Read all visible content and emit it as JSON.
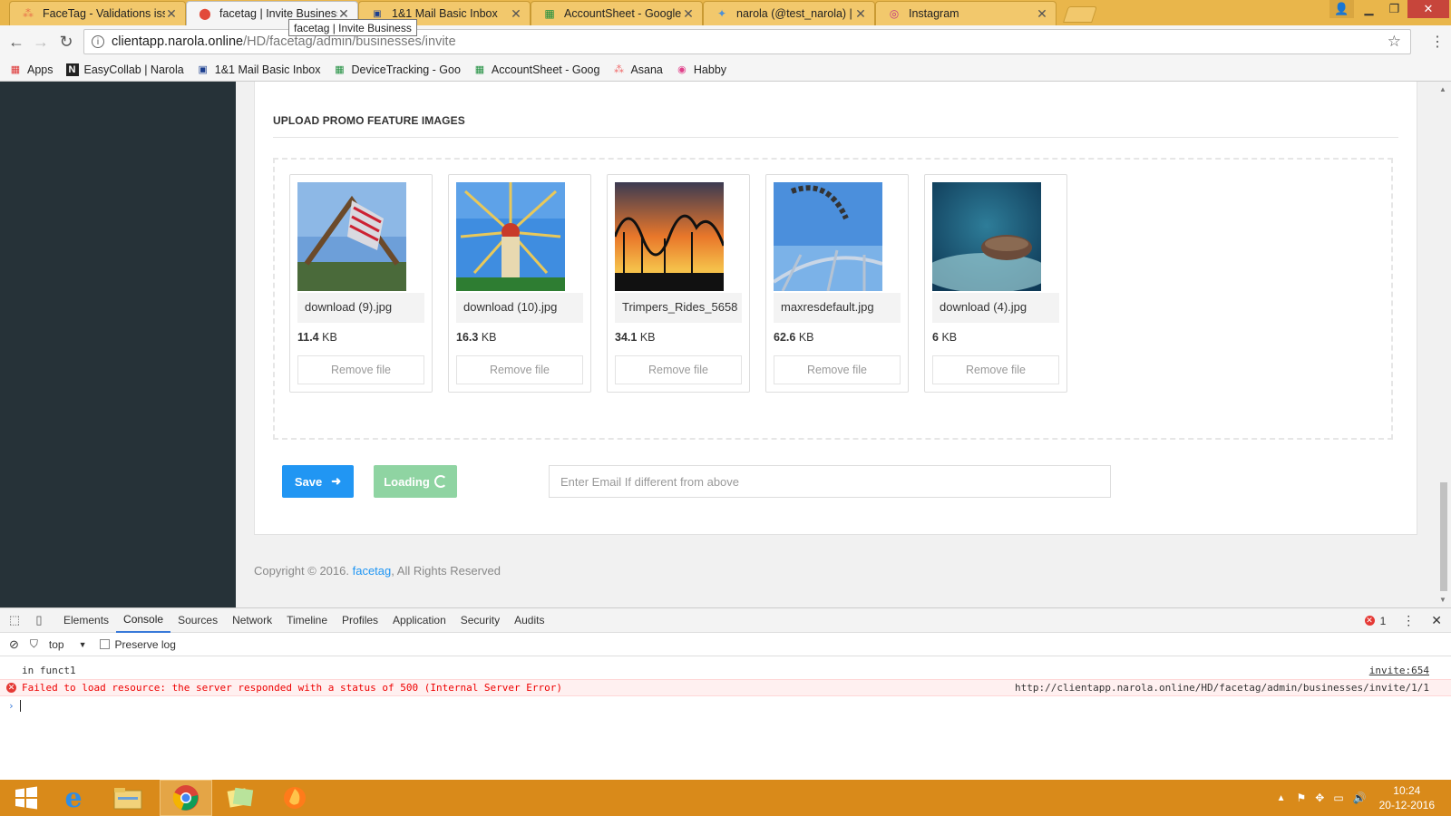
{
  "browser": {
    "tabs": [
      {
        "title": "FaceTag - Validations iss",
        "icon": "facetag-icon",
        "active": false
      },
      {
        "title": "facetag | Invite Business",
        "icon": "location-pin-icon",
        "active": true
      },
      {
        "title": "1&1 Mail Basic Inbox",
        "icon": "mail-icon",
        "active": false
      },
      {
        "title": "AccountSheet - Google S",
        "icon": "sheets-icon",
        "active": false
      },
      {
        "title": "narola (@test_narola) | Tw",
        "icon": "twitter-icon",
        "active": false
      },
      {
        "title": "Instagram",
        "icon": "instagram-icon",
        "active": false
      }
    ],
    "tooltip": "facetag | Invite Business",
    "url_host": "clientapp.narola.online",
    "url_path": "/HD/facetag/admin/businesses/invite",
    "bookmarks": [
      {
        "label": "Apps",
        "icon": "apps-grid-icon"
      },
      {
        "label": "EasyCollab | Narola",
        "icon": "n-logo-icon"
      },
      {
        "label": "1&1 Mail Basic Inbox",
        "icon": "mail-icon"
      },
      {
        "label": "DeviceTracking - Goo",
        "icon": "sheets-icon"
      },
      {
        "label": "AccountSheet - Goog",
        "icon": "sheets-icon"
      },
      {
        "label": "Asana",
        "icon": "asana-icon"
      },
      {
        "label": "Habby",
        "icon": "habby-icon"
      }
    ]
  },
  "page": {
    "section_title": "UPLOAD PROMO FEATURE IMAGES",
    "files": [
      {
        "name": "download (9).jpg",
        "size_num": "11.4",
        "size_unit": "KB",
        "remove_label": "Remove file",
        "colors": [
          "#5b8fd1",
          "#8fb6e0",
          "#7a6242",
          "#3e5f2e"
        ]
      },
      {
        "name": "download (10).jpg",
        "size_num": "16.3",
        "size_unit": "KB",
        "remove_label": "Remove file",
        "colors": [
          "#3f8de0",
          "#b8d6f2",
          "#e7c14a",
          "#c83a2a"
        ]
      },
      {
        "name": "Trimpers_Rides_5658",
        "size_num": "34.1",
        "size_unit": "KB",
        "remove_label": "Remove file",
        "colors": [
          "#3b3a52",
          "#e9772a",
          "#f5c04a",
          "#111111"
        ]
      },
      {
        "name": "maxresdefault.jpg",
        "size_num": "62.6",
        "size_unit": "KB",
        "remove_label": "Remove file",
        "colors": [
          "#2f7ad2",
          "#6ba3e2",
          "#c9d6e6",
          "#3b3b3b"
        ]
      },
      {
        "name": "download (4).jpg",
        "size_num": "6",
        "size_unit": "KB",
        "remove_label": "Remove file",
        "colors": [
          "#0f3a57",
          "#2e7d99",
          "#9ccfd6",
          "#6b4b3a"
        ]
      }
    ],
    "save_label": "Save",
    "loading_label": "Loading",
    "email_placeholder": "Enter Email If different from above",
    "footer_prefix": "Copyright © 2016.",
    "footer_link": "facetag",
    "footer_suffix": ", All Rights Reserved"
  },
  "devtools": {
    "tabs": [
      "Elements",
      "Console",
      "Sources",
      "Network",
      "Timeline",
      "Profiles",
      "Application",
      "Security",
      "Audits"
    ],
    "active_tab": "Console",
    "error_count": "1",
    "context": "top",
    "preserve_log_label": "Preserve log",
    "console_lines": [
      {
        "type": "log",
        "text": "in funct1",
        "source": "invite:654"
      },
      {
        "type": "error",
        "text": "Failed to load resource: the server responded with a status of 500 (Internal Server Error)",
        "source": "http://clientapp.narola.online/HD/facetag/admin/businesses/invite/1/1"
      }
    ]
  },
  "taskbar": {
    "time": "10:24",
    "date": "20-12-2016"
  }
}
